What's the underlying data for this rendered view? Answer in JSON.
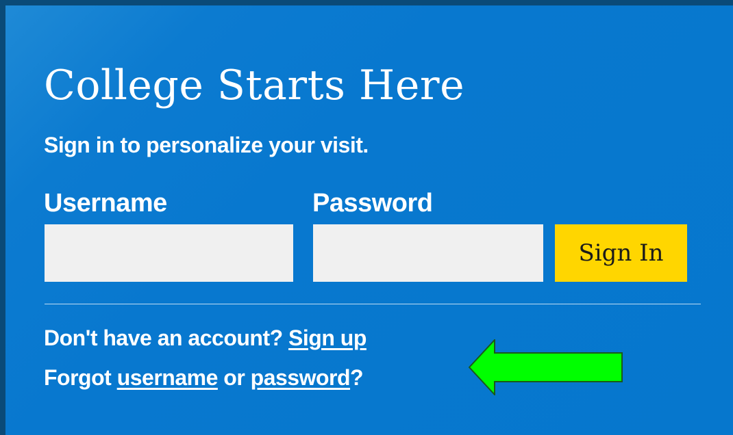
{
  "login": {
    "title": "College Starts Here",
    "subtitle": "Sign in to personalize your visit.",
    "username_label": "Username",
    "password_label": "Password",
    "username_value": "",
    "password_value": "",
    "signin_label": "Sign In",
    "signup_prompt": "Don't have an account?",
    "signup_link": "Sign up",
    "forgot_prefix": "Forgot",
    "forgot_username_link": "username",
    "forgot_or": "or",
    "forgot_password_link": "password",
    "forgot_suffix": "?"
  },
  "annotation": {
    "arrow_icon": "green-left-arrow-icon",
    "arrow_color": "#00ff00"
  },
  "colors": {
    "panel_background": "#0677cd",
    "outer_border": "#0a4a78",
    "signin_button": "#ffd600",
    "input_background": "#f0f0f0",
    "text": "#ffffff"
  }
}
